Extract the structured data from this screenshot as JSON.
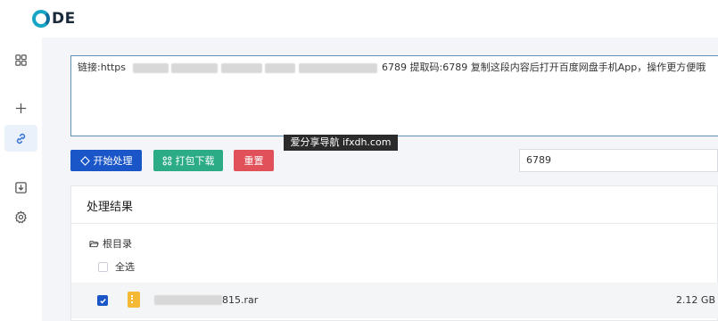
{
  "app": {
    "logo_text": "DE"
  },
  "sidebar": {
    "items": [
      {
        "name": "dashboard",
        "icon": "grid-icon"
      },
      {
        "name": "add",
        "icon": "plus-icon"
      },
      {
        "name": "link",
        "icon": "link-icon",
        "active": true
      },
      {
        "name": "download",
        "icon": "download-icon"
      },
      {
        "name": "settings",
        "icon": "gear-icon"
      }
    ]
  },
  "link_input": {
    "prefix": "链接:https",
    "suffix": "6789 提取码:6789 复制这段内容后打开百度网盘手机App，操作更方便哦"
  },
  "buttons": {
    "start_label": "开始处理",
    "pack_label": "打包下载",
    "reset_label": "重置"
  },
  "extract_code": {
    "value": "6789"
  },
  "watermark": "爱分享导航 ifxdh.com",
  "results": {
    "title": "处理结果",
    "root_label": "根目录",
    "select_all_label": "全选",
    "files": [
      {
        "name_suffix": "815.rar",
        "size": "2.12 GB",
        "checked": true
      }
    ]
  },
  "colors": {
    "primary": "#1a56c8",
    "success": "#2bab86",
    "danger": "#e0515a",
    "logo": "#17a5c6"
  }
}
